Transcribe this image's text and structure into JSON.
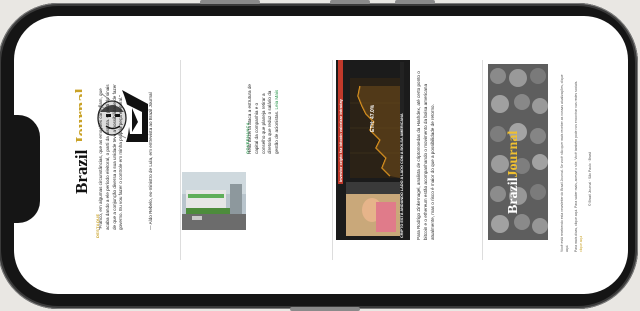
{
  "brand": {
    "part1": "Brazil",
    "part2": "Journal"
  },
  "quote_col": {
    "section": "DESTAQUE",
    "text": "“Franco, em algumas circunstâncias, que as emoções controlam, que acaba dando a ele período eleitoral, o parti da disputa. O parti do sinais de que a conjunção diversa a sua unidade teve a possibilidade de fazer governo. Eu vou fazer o controle em minha própria peça eleitoral.”",
    "attribution": "— Aldo Rebelo, ex-ministro de Lula, em entrevista ao Brazil Journal"
  },
  "gov_col": {
    "section": "GOVERNANÇA",
    "text": "Hélio Bezerra ataca a estrutura de capital da companhia e o conselho que planeja retirar a diretoria que reduz o salário da gestão de acionistas.",
    "link": "Leia Mais"
  },
  "chart_card": {
    "headline": "Investor cripto faz bitcoin valorizar intraday",
    "price_label": "ETH: 47.0%",
    "caption": "CRIPTO ESTÁ ANDANDO LADO A LADO COM A BOLSA AMERICANA",
    "text": "Para Rodrigo Zinkernagel, analista de criptomoedas da Hashdex, até certo ponto o bitcoin e o ethereum estão acompanhando o movimento da bolsa americana atualmente, mas o risco é maior do que a possibilidade de retorno."
  },
  "footer": {
    "line1": "Você está recebendo esta newsletter do Brazil Journal. Se você não quer mais receber as nossas atualizações, clique aqui.",
    "line2": "Para mais dicas, clique aqui. Para saber mais, acesse o site. Você também pode nos encontrar nas redes sociais.",
    "link": "clique aqui",
    "copyright": "© Brazil Journal · São Paulo · Brasil"
  },
  "colors": {
    "gold": "#c9a227",
    "green": "#2f9a52",
    "frame": "#151515"
  }
}
